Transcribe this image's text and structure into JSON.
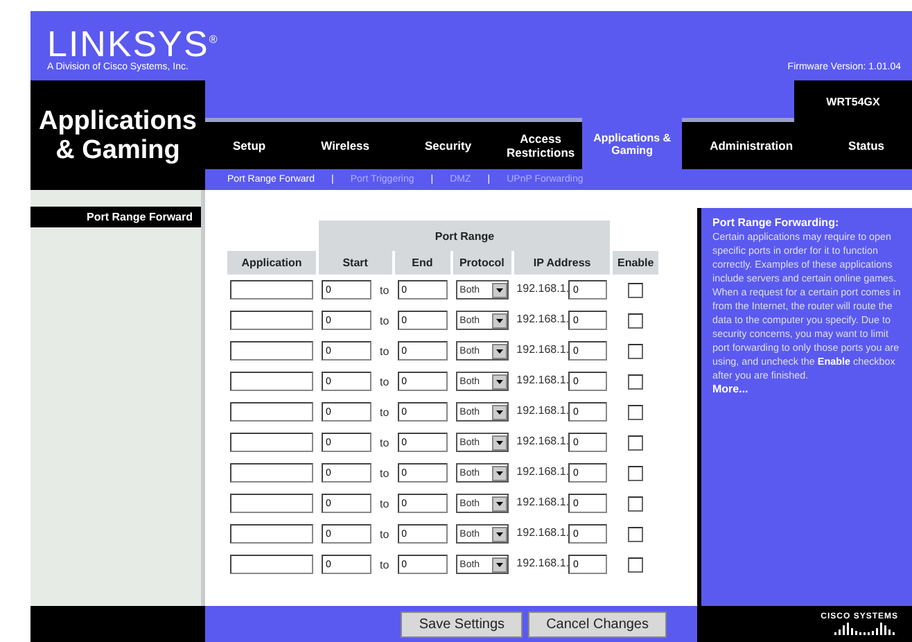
{
  "header": {
    "logo": "LINKSYS$^{®}$",
    "logo_subtitle": "A Division of Cisco Systems, Inc.",
    "firmware": "Firmware Version: 1.01.04"
  },
  "section_title": "Applications & Gaming",
  "model": "WRT54GX",
  "tabs": [
    {
      "label": "Setup",
      "selected": false
    },
    {
      "label": "Wireless",
      "selected": false
    },
    {
      "label": "Security",
      "selected": false
    },
    {
      "label": "Access Restrictions",
      "selected": false
    },
    {
      "label": "Applications & Gaming",
      "selected": true
    },
    {
      "label": "Administration",
      "selected": false
    },
    {
      "label": "Status",
      "selected": false
    }
  ],
  "subtab_separator": "|",
  "subtabs": [
    {
      "label": "Port Range Forward",
      "selected": true
    },
    {
      "label": "Port Triggering",
      "selected": false
    },
    {
      "label": "DMZ",
      "selected": false
    },
    {
      "label": "UPnP Forwarding",
      "selected": false
    }
  ],
  "sidebar_heading": "Port Range Forward",
  "table": {
    "group_heading": "Port Range",
    "columns": [
      "Application",
      "Start",
      "End",
      "Protocol",
      "IP Address",
      "Enable"
    ],
    "rows": [
      {
        "start": "0",
        "to": "to",
        "end": "0",
        "protocol": "Both",
        "ip_prefix": "192.168.1.",
        "ip_last": "0",
        "enable": false
      },
      {
        "start": "0",
        "to": "to",
        "end": "0",
        "protocol": "Both",
        "ip_prefix": "192.168.1.",
        "ip_last": "0",
        "enable": false
      },
      {
        "start": "0",
        "to": "to",
        "end": "0",
        "protocol": "Both",
        "ip_prefix": "192.168.1.",
        "ip_last": "0",
        "enable": false
      },
      {
        "start": "0",
        "to": "to",
        "end": "0",
        "protocol": "Both",
        "ip_prefix": "192.168.1.",
        "ip_last": "0",
        "enable": false
      },
      {
        "start": "0",
        "to": "to",
        "end": "0",
        "protocol": "Both",
        "ip_prefix": "192.168.1.",
        "ip_last": "0",
        "enable": false
      },
      {
        "start": "0",
        "to": "to",
        "end": "0",
        "protocol": "Both",
        "ip_prefix": "192.168.1.",
        "ip_last": "0",
        "enable": false
      },
      {
        "start": "0",
        "to": "to",
        "end": "0",
        "protocol": "Both",
        "ip_prefix": "192.168.1.",
        "ip_last": "0",
        "enable": false
      },
      {
        "start": "0",
        "to": "to",
        "end": "0",
        "protocol": "Both",
        "ip_prefix": "192.168.1.",
        "ip_last": "0",
        "enable": false
      },
      {
        "start": "0",
        "to": "to",
        "end": "0",
        "protocol": "Both",
        "ip_prefix": "192.168.1.",
        "ip_last": "0",
        "enable": false
      },
      {
        "start": "0",
        "to": "to",
        "end": "0",
        "protocol": "Both",
        "ip_prefix": "192.168.1.",
        "ip_last": "0",
        "enable": false
      }
    ]
  },
  "help": {
    "title": "Port Range Forwarding:",
    "text": "Certain applications may require to open specific ports in order for it to function correctly. Examples of these applications include servers and certain online games. When a request for a certain port comes in from the Internet, the router will route the data to the computer you specify. Due to security concerns, you may want to limit port forwarding to only those ports you are using, and uncheck the **Enable** checkbox after you are finished.",
    "more": "More..."
  },
  "buttons": [
    "Save Settings",
    "Cancel Changes"
  ],
  "footer_logo": "CISCO SYSTEMS"
}
